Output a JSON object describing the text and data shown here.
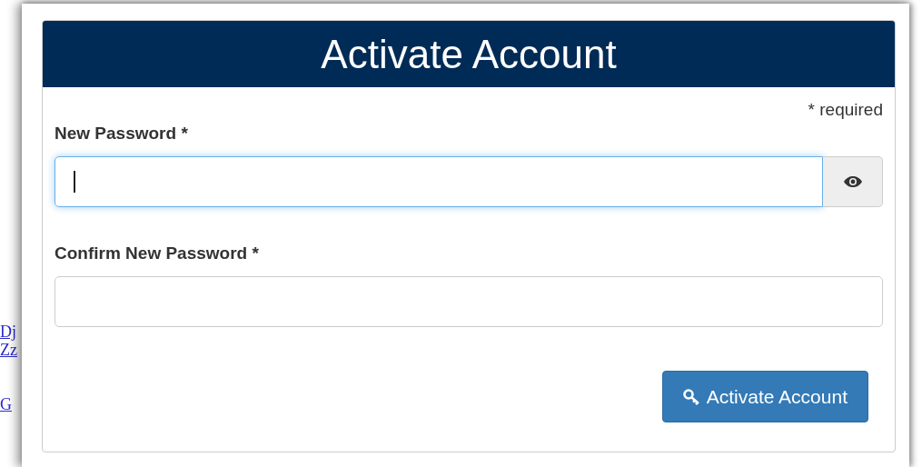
{
  "background_links": [
    "Dj",
    "Zz",
    "G"
  ],
  "dialog": {
    "title": "Activate Account",
    "required_note": "* required",
    "fields": [
      {
        "label": "New Password *",
        "focused": true,
        "reveal_button": true
      },
      {
        "label": "Confirm New Password *",
        "focused": false,
        "reveal_button": false
      }
    ],
    "submit_button": "Activate Account"
  }
}
